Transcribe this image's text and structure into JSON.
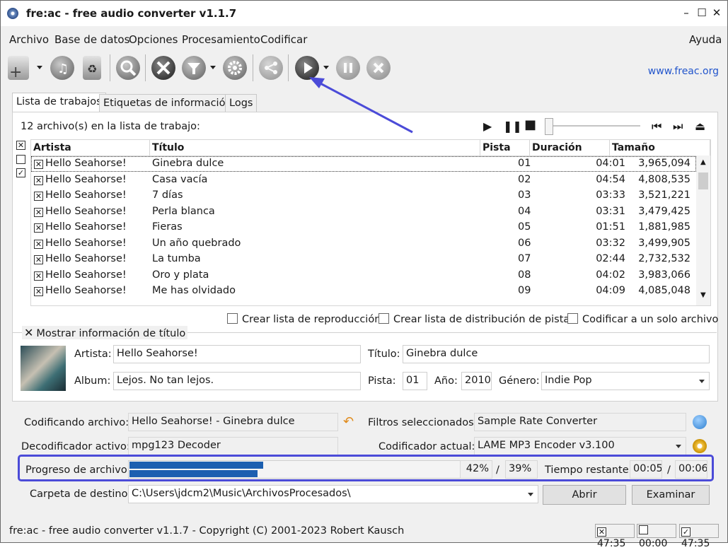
{
  "window": {
    "title": "fre:ac - free audio converter v1.1.7"
  },
  "menu": {
    "items": [
      "Archivo",
      "Base de datos",
      "Opciones",
      "Procesamiento",
      "Codificar"
    ],
    "help": "Ayuda"
  },
  "toolbar": {
    "link": "www.freac.org",
    "icons": [
      "add-files-icon",
      "add-cd-icon",
      "remove-icon",
      "cddb-icon",
      "tools-icon",
      "filter-icon",
      "settings-icon",
      "share-icon",
      "play-icon",
      "pause-icon",
      "stop-icon"
    ]
  },
  "tabs": [
    "Lista de trabajos",
    "Etiquetas de información",
    "Logs"
  ],
  "joblist": {
    "count_text": "12 archivo(s) en la lista de trabajo:",
    "columns": [
      "Artista",
      "Título",
      "Pista",
      "Duración",
      "Tamaño"
    ],
    "rows": [
      {
        "artist": "Hello Seahorse!",
        "title": "Ginebra dulce",
        "track": "01",
        "duration": "04:01",
        "size": "3,965,094"
      },
      {
        "artist": "Hello Seahorse!",
        "title": "Casa vacía",
        "track": "02",
        "duration": "04:54",
        "size": "4,808,535"
      },
      {
        "artist": "Hello Seahorse!",
        "title": "7 días",
        "track": "03",
        "duration": "03:33",
        "size": "3,521,221"
      },
      {
        "artist": "Hello Seahorse!",
        "title": "Perla blanca",
        "track": "04",
        "duration": "03:31",
        "size": "3,479,425"
      },
      {
        "artist": "Hello Seahorse!",
        "title": "Fieras",
        "track": "05",
        "duration": "01:51",
        "size": "1,881,985"
      },
      {
        "artist": "Hello Seahorse!",
        "title": "Un año quebrado",
        "track": "06",
        "duration": "03:32",
        "size": "3,499,905"
      },
      {
        "artist": "Hello Seahorse!",
        "title": "La tumba",
        "track": "07",
        "duration": "02:44",
        "size": "2,732,532"
      },
      {
        "artist": "Hello Seahorse!",
        "title": "Oro y plata",
        "track": "08",
        "duration": "04:02",
        "size": "3,983,066"
      },
      {
        "artist": "Hello Seahorse!",
        "title": "Me has olvidado",
        "track": "09",
        "duration": "04:09",
        "size": "4,085,048"
      }
    ]
  },
  "options": {
    "playlist": "Crear lista de reproducción",
    "cuesheet": "Crear lista de distribución de pistas",
    "single_file": "Codificar a un solo archivo"
  },
  "info": {
    "show_title": "Mostrar información de título",
    "artist_label": "Artista:",
    "artist": "Hello Seahorse!",
    "title_label": "Título:",
    "title": "Ginebra dulce",
    "album_label": "Album:",
    "album": "Lejos. No tan lejos.",
    "track_label": "Pista:",
    "track": "01",
    "year_label": "Año:",
    "year": "2010",
    "genre_label": "Género:",
    "genre": "Indie Pop"
  },
  "encoding": {
    "file_label": "Codificando archivo:",
    "file": "Hello Seahorse! - Ginebra dulce",
    "filters_label": "Filtros seleccionados:",
    "filters": "Sample Rate Converter",
    "decoder_label": "Decodificador activo:",
    "decoder": "mpg123 Decoder",
    "encoder_label": "Codificador actual:",
    "encoder": "LAME MP3 Encoder v3.100",
    "progress_label": "Progreso de archivo:",
    "file_progress_pct": "42%",
    "slash1": "/",
    "total_progress_pct": "39%",
    "file_progress": 0.42,
    "total_progress": 0.39,
    "remaining_label": "Tiempo restante:",
    "time_remaining": "00:05",
    "slash2": "/",
    "time_total": "00:06",
    "dest_label": "Carpeta de destino:",
    "dest": "C:\\Users\\jdcm2\\Music\\ArchivosProcesados\\",
    "open_button": "Abrir",
    "browse_button": "Examinar"
  },
  "status": {
    "text": "fre:ac - free audio converter v1.1.7 - Copyright (C) 2001-2023 Robert Kausch",
    "sel_time": "47:35",
    "unsel_time": "00:00",
    "total_time": "47:35"
  }
}
